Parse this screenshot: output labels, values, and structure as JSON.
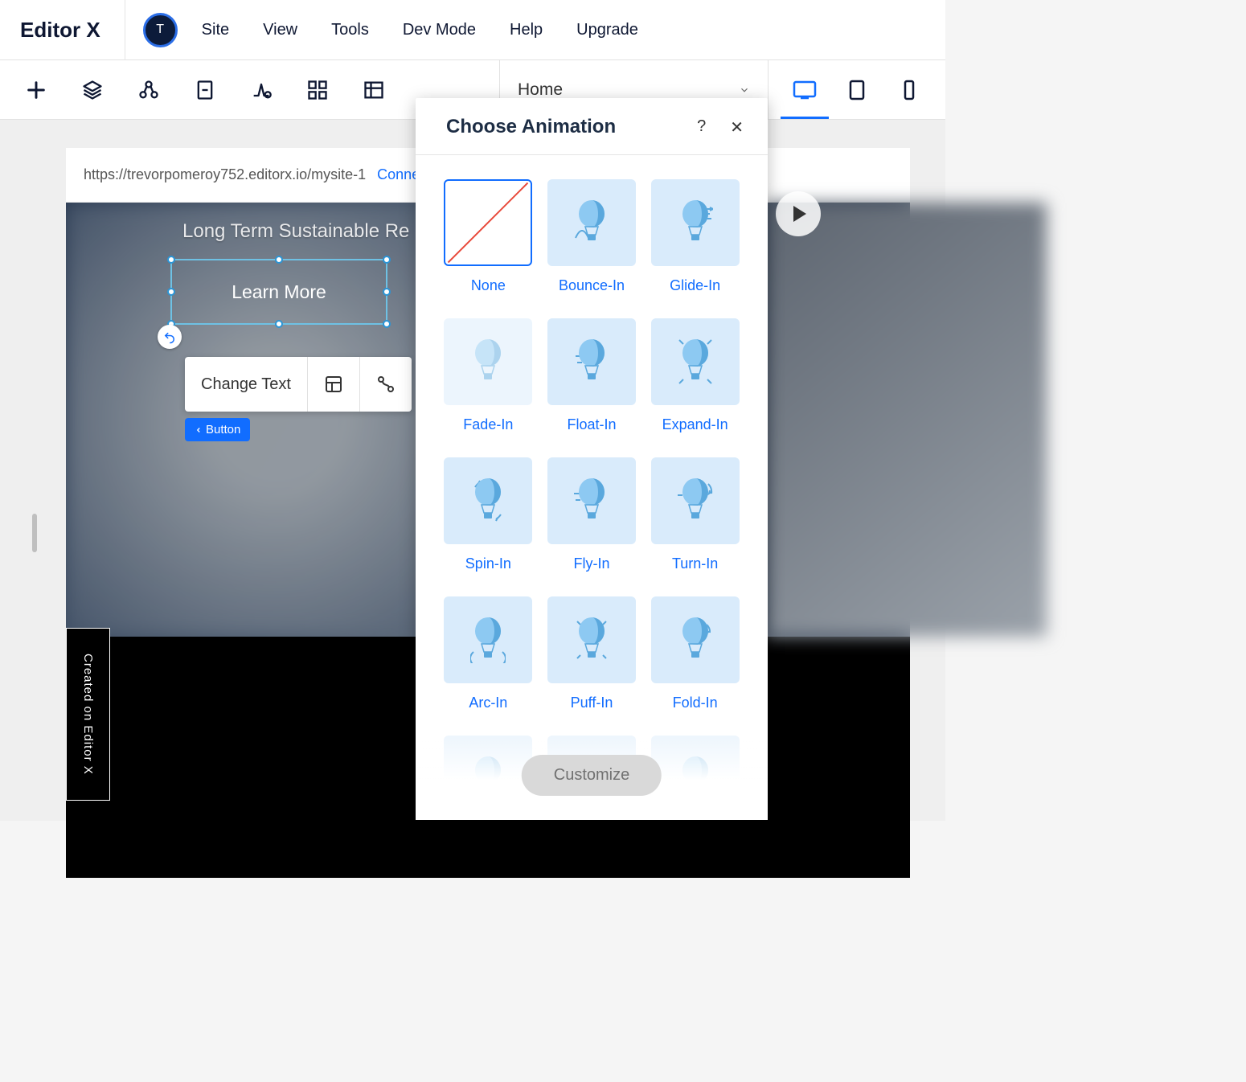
{
  "logo": "Editor X",
  "avatar_initial": "T",
  "menu": [
    "Site",
    "View",
    "Tools",
    "Dev Mode",
    "Help",
    "Upgrade"
  ],
  "page_dropdown": "Home",
  "url": "https://trevorpomeroy752.editorx.io/mysite-1",
  "connect_label": "Connect",
  "hero_subtitle": "Long Term Sustainable Re",
  "selected_button_text": "Learn More",
  "floating_toolbar": {
    "change_text": "Change Text"
  },
  "breadcrumb_tag": "Button",
  "created_badge": "Created on Editor X",
  "panel": {
    "title": "Choose Animation",
    "help": "?",
    "close": "✕",
    "customize": "Customize",
    "animations": [
      {
        "label": "None",
        "selected": true
      },
      {
        "label": "Bounce-In"
      },
      {
        "label": "Glide-In"
      },
      {
        "label": "Fade-In"
      },
      {
        "label": "Float-In"
      },
      {
        "label": "Expand-In"
      },
      {
        "label": "Spin-In"
      },
      {
        "label": "Fly-In"
      },
      {
        "label": "Turn-In"
      },
      {
        "label": "Arc-In"
      },
      {
        "label": "Puff-In"
      },
      {
        "label": "Fold-In"
      }
    ]
  }
}
